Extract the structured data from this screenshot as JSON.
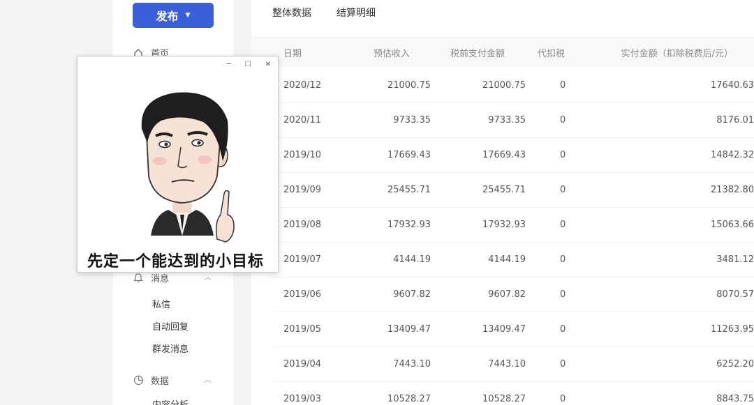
{
  "sidebar": {
    "publish_label": "发布",
    "home_label": "首页",
    "messages": {
      "label": "消息",
      "items": [
        "私信",
        "自动回复",
        "群发消息"
      ]
    },
    "data": {
      "label": "数据",
      "items": [
        "内容分析"
      ]
    }
  },
  "tabs": [
    "整体数据",
    "结算明细"
  ],
  "table": {
    "headers": [
      "日期",
      "预估收入",
      "税前支付金额",
      "代扣税",
      "实付金额（扣除税费后/元）"
    ],
    "rows": [
      [
        "2020/12",
        "21000.75",
        "21000.75",
        "0",
        "17640.63"
      ],
      [
        "2020/11",
        "9733.35",
        "9733.35",
        "0",
        "8176.01"
      ],
      [
        "2019/10",
        "17669.43",
        "17669.43",
        "0",
        "14842.32"
      ],
      [
        "2019/09",
        "25455.71",
        "25455.71",
        "0",
        "21382.80"
      ],
      [
        "2019/08",
        "17932.93",
        "17932.93",
        "0",
        "15063.66"
      ],
      [
        "2019/07",
        "4144.19",
        "4144.19",
        "0",
        "3481.12"
      ],
      [
        "2019/06",
        "9607.82",
        "9607.82",
        "0",
        "8070.57"
      ],
      [
        "2019/05",
        "13409.47",
        "13409.47",
        "0",
        "11263.95"
      ],
      [
        "2019/04",
        "7443.10",
        "7443.10",
        "0",
        "6252.20"
      ],
      [
        "2019/03",
        "10528.27",
        "10528.27",
        "0",
        "8843.75"
      ]
    ]
  },
  "popup": {
    "caption": "先定一个能达到的小目标",
    "controls": [
      "─",
      "☐",
      "✕"
    ]
  },
  "colors": {
    "accent": "#3a5fd8"
  }
}
